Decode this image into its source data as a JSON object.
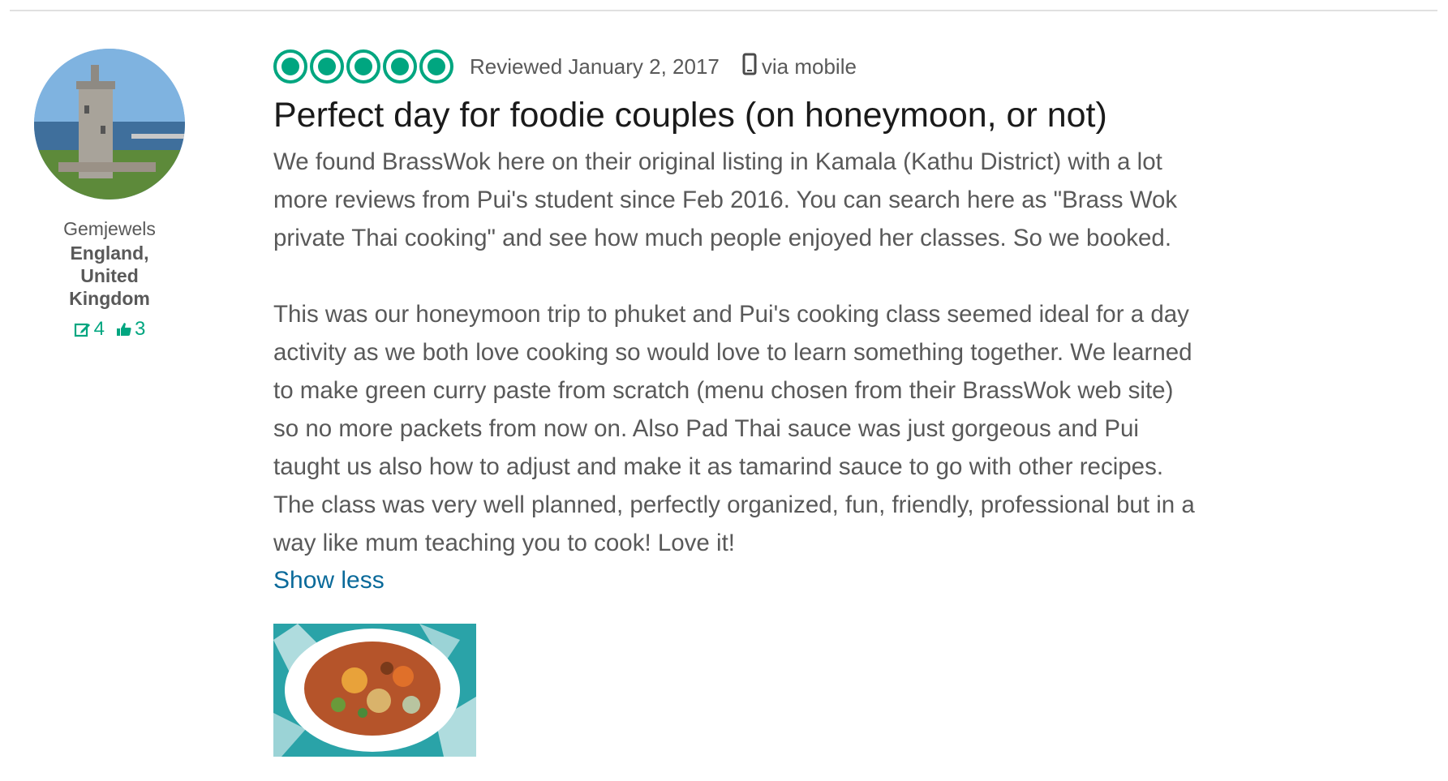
{
  "member": {
    "username": "Gemjewels",
    "location": "England, United Kingdom",
    "contributions_count": "4",
    "helpful_votes_count": "3"
  },
  "review": {
    "rating": 5,
    "rating_max": 5,
    "date_label": "Reviewed January 2, 2017",
    "via_label": "via mobile",
    "title": "Perfect day for foodie couples (on honeymoon, or not)",
    "paragraphs": [
      "We found BrassWok here on their original listing in Kamala (Kathu District) with a lot\nmore reviews from Pui's student since Feb 2016. You can search here as \"Brass Wok\nprivate Thai cooking\" and see how much people enjoyed her classes. So we booked.",
      "This was our honeymoon trip to phuket and Pui's cooking class seemed ideal for a day\nactivity as we both love cooking so would love to learn something together. We learned\nto make green curry paste from scratch (menu chosen from their BrassWok web site)\nso no more packets from now on. Also Pad Thai sauce was just gorgeous and Pui\ntaught us also how to adjust and make it as tamarind sauce to go with other recipes.\nThe class was very well planned, perfectly organized, fun, friendly, professional but in a\nway like mum teaching you to cook! Love it!"
    ],
    "show_less_label": "Show less"
  },
  "colors": {
    "brand_green": "#00a680",
    "link_blue": "#0a6a9a",
    "text_gray": "#595959",
    "title_dark": "#1a1a1a"
  },
  "icons": {
    "bubble": "rating-bubble-icon",
    "mobile": "mobile-phone-icon",
    "contributions": "pencil-edit-icon",
    "helpful": "thumbs-up-icon"
  }
}
